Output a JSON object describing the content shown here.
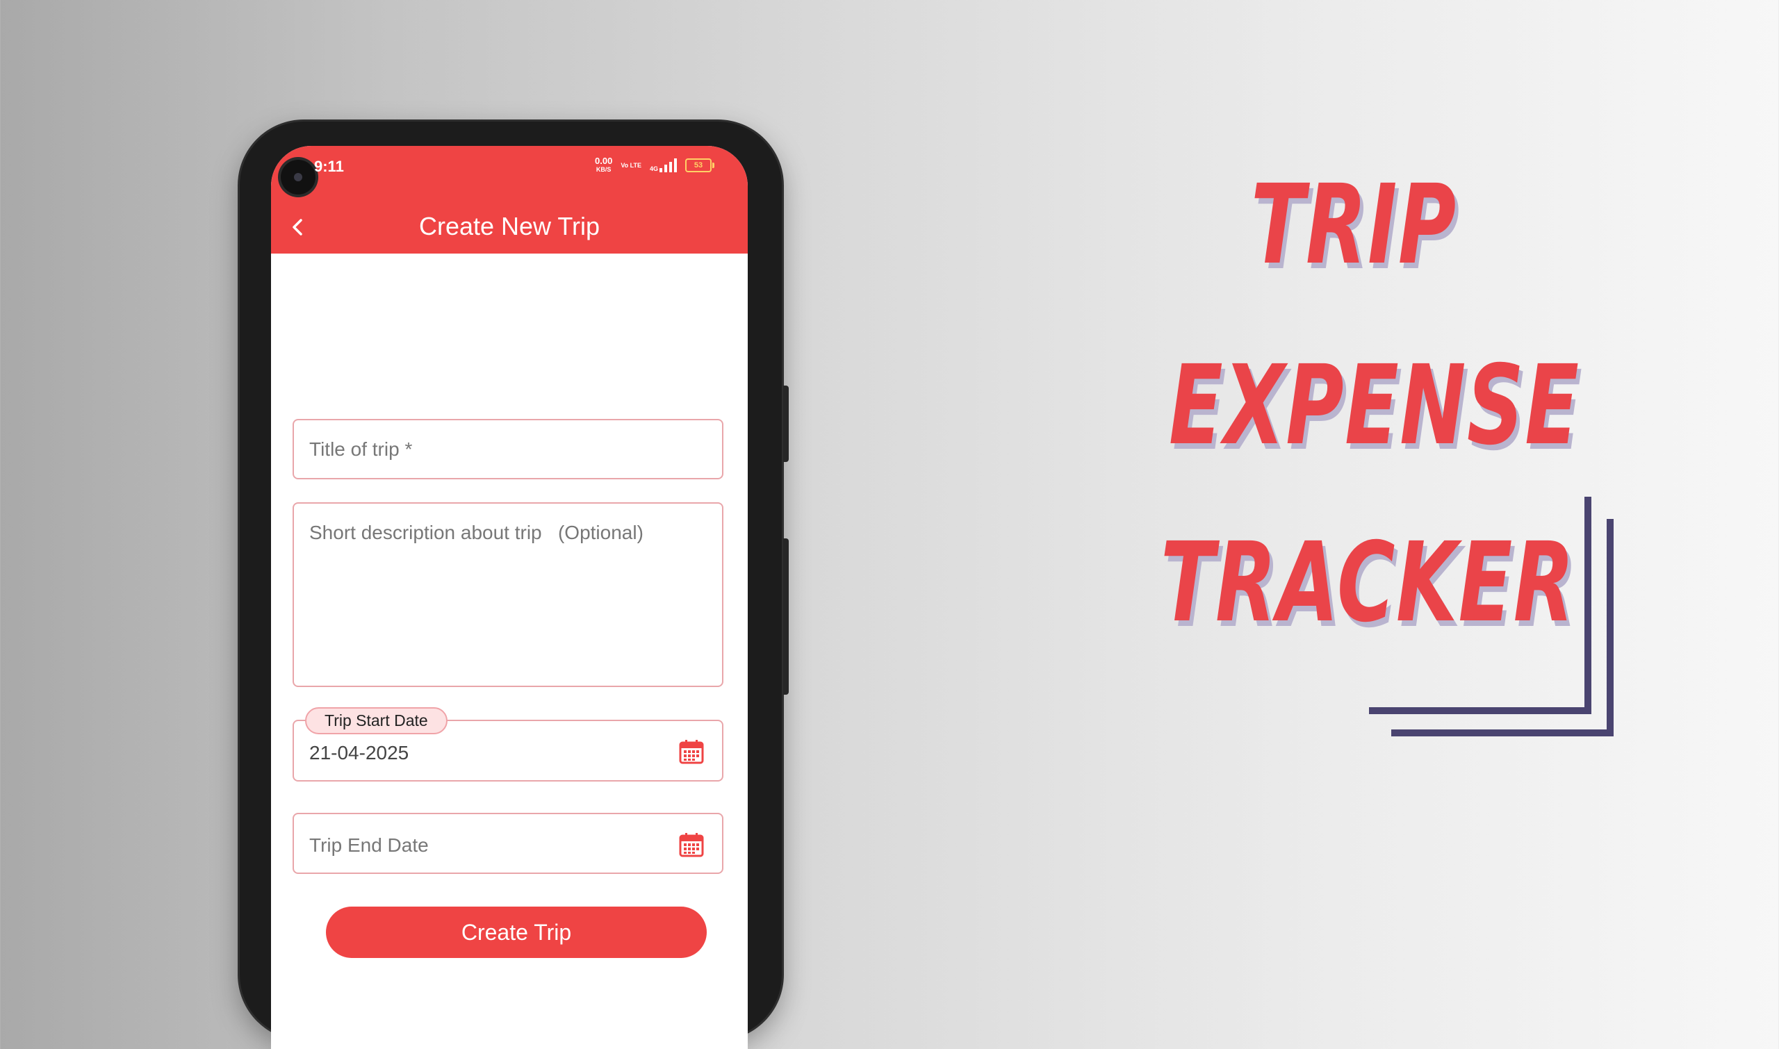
{
  "status_bar": {
    "time": "9:11",
    "net_speed": "0.00",
    "net_unit": "KB/S",
    "volte": "Vo LTE",
    "network": "4G",
    "battery": "53"
  },
  "appbar": {
    "back_icon": "chevron-left-icon",
    "title": "Create New Trip"
  },
  "form": {
    "title_placeholder": "Title of trip *",
    "description_placeholder": "Short description about trip   (Optional)",
    "start_date_label": "Trip Start Date",
    "start_date_value": "21-04-2025",
    "end_date_placeholder": "Trip End Date",
    "calendar_icon": "calendar-icon",
    "submit_label": "Create Trip"
  },
  "headline": {
    "line1": "TRIP",
    "line2": "EXPENSE",
    "line3": "TRACKER"
  },
  "colors": {
    "accent": "#ef4444",
    "field_border": "#e9a6aa",
    "headline": "#ea4449",
    "headline_shadow": "#b9b4cf",
    "corner_lines": "#4a4470"
  }
}
